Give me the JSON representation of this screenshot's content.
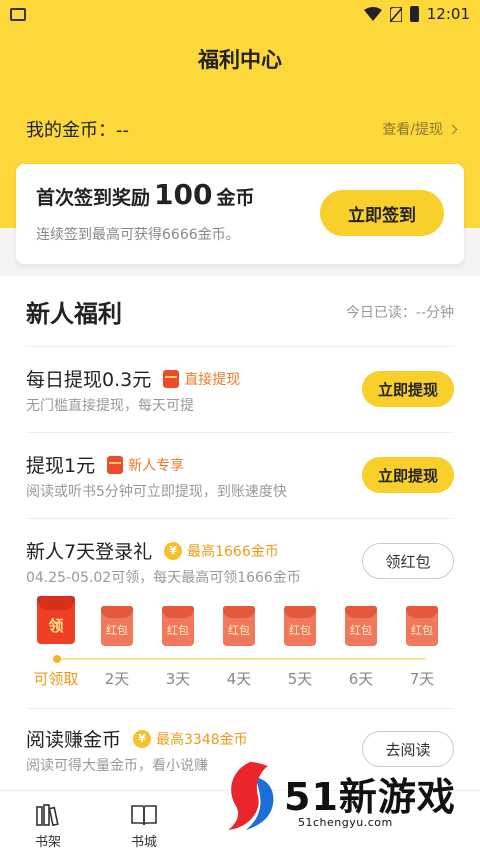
{
  "status_bar": {
    "time": "12:01"
  },
  "page": {
    "title": "福利中心"
  },
  "coins": {
    "label": "我的金币：--",
    "link": "查看/提现"
  },
  "sign_card": {
    "title_pre": "首次签到奖励",
    "title_num": "100",
    "title_post": "金币",
    "subtitle": "连续签到最高可获得6666金币。",
    "button": "立即签到"
  },
  "section": {
    "title": "新人福利",
    "read_today": "今日已读：--分钟",
    "tasks": [
      {
        "name": "每日提现0.3元",
        "tag": "直接提现",
        "desc": "无门槛直接提现，每天可提",
        "button": "立即提现"
      },
      {
        "name": "提现1元",
        "tag": "新人专享",
        "desc": "阅读或听书5分钟可立即提现，到账速度快",
        "button": "立即提现"
      },
      {
        "name": "新人7天登录礼",
        "tag": "最高1666金币",
        "desc": "04.25-05.02可领，每天最高可领1666金币",
        "button": "领红包"
      },
      {
        "name": "阅读赚金币",
        "tag": "最高3348金币",
        "desc": "阅读可得大量金币，看小说赚",
        "button": "去阅读"
      }
    ],
    "login_days": {
      "big_label": "领",
      "small_label": "红包",
      "days": [
        "可领取",
        "2天",
        "3天",
        "4天",
        "5天",
        "6天",
        "7天"
      ]
    }
  },
  "bottom_nav": {
    "items": [
      "书架",
      "书城"
    ]
  },
  "watermark": {
    "text": "51新游戏",
    "url": "51chengyu.com"
  },
  "colors": {
    "brand_yellow": "#fcd83b",
    "button_yellow": "#f9cf2c",
    "tag_orange": "#f07a2a",
    "envelope_red": "#ee3f26"
  }
}
